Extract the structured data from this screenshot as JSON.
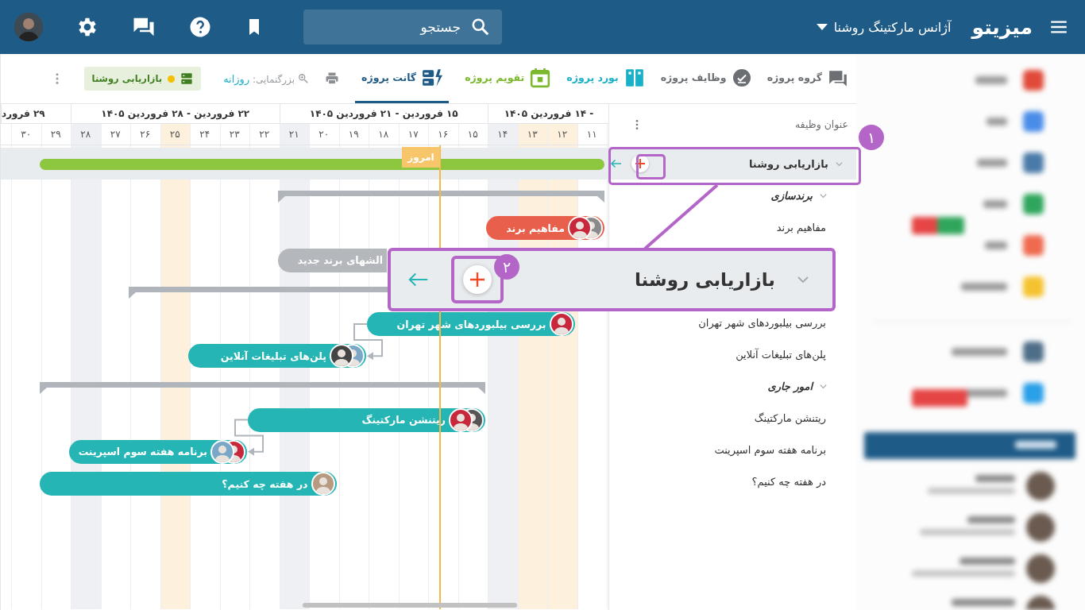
{
  "topbar": {
    "logo": "میزیتو",
    "workspace": "آژانس مارکتینگ روشنا",
    "search": {
      "placeholder": "جستجو"
    }
  },
  "toolbar": {
    "tabs": [
      {
        "label": "گروه پروژه",
        "kind": "group",
        "color": "#6b6e72",
        "selected": false
      },
      {
        "label": "وظایف پروژه",
        "kind": "tasks",
        "color": "#6b6e72",
        "selected": false
      },
      {
        "label": "بورد پروژه",
        "kind": "board",
        "color": "#1ab0c8",
        "selected": false
      },
      {
        "label": "تقویم پروژه",
        "kind": "calendar",
        "color": "#7cb82f",
        "selected": false
      },
      {
        "label": "گانت پروژه",
        "kind": "gantt",
        "color": "#1f5b87",
        "selected": true
      }
    ],
    "zoom": {
      "label": "بزرگنمایی:",
      "value": "روزانه"
    },
    "project_chip": {
      "label": "بازاریابی روشنا"
    }
  },
  "task_list": {
    "header": "عنوان وظیفه",
    "rows": [
      {
        "kind": "project",
        "title": "بازاریابی روشنا",
        "expanded": true,
        "selected": true,
        "bar": {
          "color": "#8dc63f"
        },
        "children": [
          {
            "kind": "group",
            "title": "برندسازی",
            "expanded": true,
            "selected": false,
            "children": [
              {
                "kind": "task",
                "title": "مفاهیم برند",
                "selected": false,
                "bar": {
                  "label": "مفاهیم برند",
                  "color": "#e8604c",
                  "avatars": [
                    {
                      "color": "#8a8a8a"
                    },
                    {
                      "color": "#c8283c"
                    }
                  ]
                }
              },
              {
                "kind": "task",
                "selected": false,
                "bar": {
                  "label": "الشهای برند جدید",
                  "color": "#b4b7bb"
                }
              }
            ]
          },
          {
            "kind": "group",
            "selected": false,
            "children": [
              {
                "kind": "task",
                "title": "بررسی بیلبوردهای شهر تهران",
                "selected": false,
                "bar": {
                  "label": "بررسی بیلبوردهای شهر تهران",
                  "color": "#26b5b5",
                  "avatars": [
                    {
                      "color": "#c8283c"
                    }
                  ]
                }
              },
              {
                "kind": "task",
                "title": "پلن‌های تبلیغات آنلاین",
                "selected": false,
                "bar": {
                  "label": "پلن‌های تبلیغات آنلاین",
                  "color": "#26b5b5",
                  "depends_on_previous": true,
                  "avatars": [
                    {
                      "color": "#7aa7c7"
                    },
                    {
                      "color": "#444444"
                    }
                  ]
                }
              }
            ]
          },
          {
            "kind": "group",
            "title": "امور جاری",
            "expanded": true,
            "selected": false,
            "children": [
              {
                "kind": "task",
                "title": "ریتنشن مارکتینگ",
                "selected": false,
                "bar": {
                  "label": "ریتنشن مارکتینگ",
                  "color": "#26b5b5",
                  "avatars": [
                    {
                      "color": "#555555"
                    },
                    {
                      "color": "#c8283c"
                    }
                  ]
                }
              },
              {
                "kind": "task",
                "title": "برنامه هفته سوم اسپرینت",
                "selected": false,
                "bar": {
                  "label": "برنامه هفته سوم اسپرینت",
                  "color": "#26b5b5",
                  "depends_on_previous": true,
                  "avatars": [
                    {
                      "color": "#c8283c"
                    },
                    {
                      "color": "#7aa7c7"
                    }
                  ]
                }
              },
              {
                "kind": "task",
                "title": "در هفته چه کنیم؟",
                "selected": false,
                "bar": {
                  "label": "در هفته چه کنیم؟",
                  "color": "#26b5b5",
                  "avatars": [
                    {
                      "color": "#b89a80"
                    }
                  ]
                }
              }
            ]
          }
        ]
      }
    ]
  },
  "chart": {
    "weeks": [
      {
        "label": "- ۱۴ فروردین ۱۴۰۵"
      },
      {
        "label": "۱۵ فروردین - ۲۱ فروردین ۱۴۰۵"
      },
      {
        "label": "۲۲ فروردین - ۲۸ فروردین ۱۴۰۵"
      },
      {
        "label": "۲۹ فرورد"
      }
    ],
    "days": [
      {
        "label": "۱۱",
        "kind": "normal"
      },
      {
        "label": "۱۲",
        "kind": "holiday"
      },
      {
        "label": "۱۳",
        "kind": "holiday"
      },
      {
        "label": "۱۴",
        "kind": "weekend"
      },
      {
        "label": "۱۵",
        "kind": "normal"
      },
      {
        "label": "۱۶",
        "kind": "normal"
      },
      {
        "label": "۱۷",
        "kind": "normal"
      },
      {
        "label": "۱۸",
        "kind": "normal"
      },
      {
        "label": "۱۹",
        "kind": "normal"
      },
      {
        "label": "۲۰",
        "kind": "normal"
      },
      {
        "label": "۲۱",
        "kind": "weekend"
      },
      {
        "label": "۲۲",
        "kind": "normal"
      },
      {
        "label": "۲۳",
        "kind": "normal"
      },
      {
        "label": "۲۴",
        "kind": "normal"
      },
      {
        "label": "۲۵",
        "kind": "holiday"
      },
      {
        "label": "۲۶",
        "kind": "normal"
      },
      {
        "label": "۲۷",
        "kind": "normal"
      },
      {
        "label": "۲۸",
        "kind": "weekend"
      },
      {
        "label": "۲۹",
        "kind": "normal"
      },
      {
        "label": "۳۰",
        "kind": "normal"
      }
    ],
    "today": {
      "label": "امروز"
    }
  },
  "callouts": [
    {
      "number": "۱"
    },
    {
      "number": "۲",
      "title": "بازاریابی روشنا"
    }
  ]
}
